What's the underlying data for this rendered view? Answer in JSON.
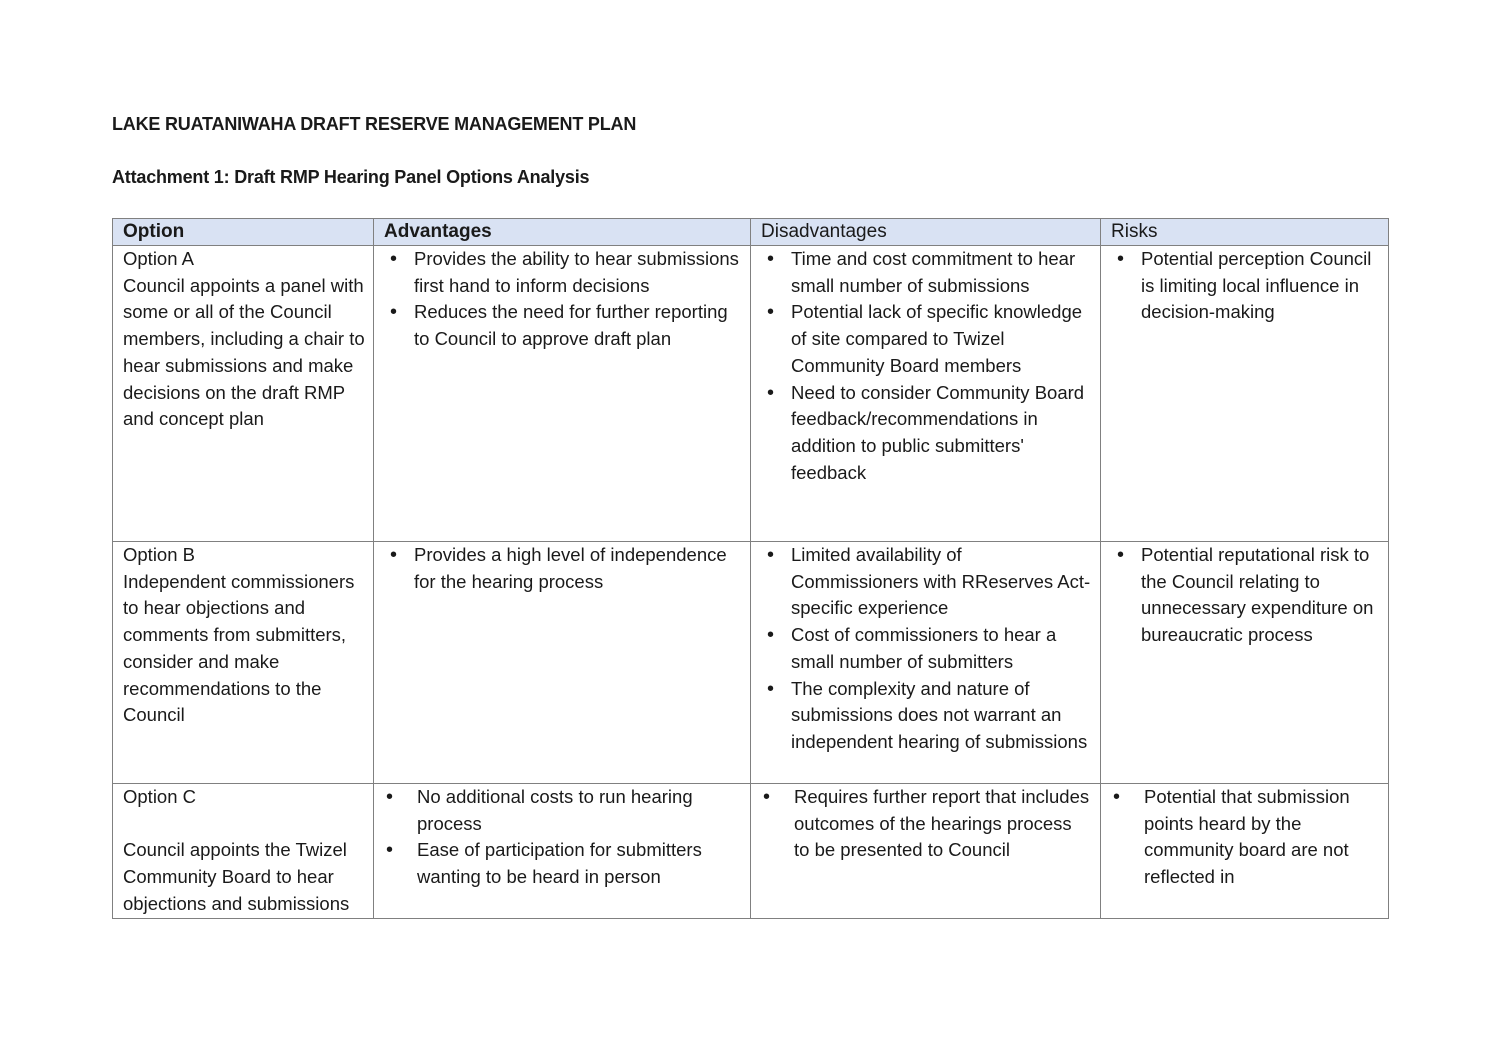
{
  "document": {
    "title": "LAKE RUATANIWAHA DRAFT RESERVE MANAGEMENT PLAN",
    "subtitle": "Attachment 1: Draft RMP Hearing Panel Options Analysis"
  },
  "table": {
    "header_bg": "#d9e2f3",
    "headers": [
      "Option",
      "Advantages",
      "Disadvantages",
      "Risks"
    ],
    "rows": [
      {
        "option_name": "Option A",
        "option_desc": "Council appoints a panel with some or all of the Council members, including a chair to hear submissions and make decisions on the draft RMP and concept plan",
        "advantages": [
          "Provides the ability to hear submissions first hand to inform decisions",
          "Reduces the need for further reporting to Council to approve draft plan"
        ],
        "disadvantages": [
          "Time and cost commitment to hear small number of submissions",
          "Potential lack of specific knowledge of site compared to Twizel Community Board members",
          "Need to consider Community Board feedback/recommendations in addition to public submitters' feedback"
        ],
        "risks": [
          "Potential perception Council is limiting local influence in decision-making"
        ]
      },
      {
        "option_name": "Option B",
        "option_desc": "Independent commissioners to hear objections and comments from submitters, consider and make recommendations to the Council",
        "advantages": [
          "Provides a high level of independence for the hearing process"
        ],
        "disadvantages": [
          "Limited availability of Commissioners with RReserves Act-specific experience",
          "Cost of commissioners to hear a small number of submitters",
          "The complexity and nature of submissions does not warrant an independent hearing of submissions"
        ],
        "risks": [
          "Potential reputational risk to the Council relating to unnecessary expenditure on bureaucratic process"
        ]
      },
      {
        "option_name": "Option C",
        "option_desc": "Council appoints the Twizel Community Board to hear objections and submissions",
        "advantages": [
          "No additional costs to run hearing process",
          "Ease of participation for submitters wanting to be heard in person"
        ],
        "disadvantages": [
          "Requires further report that includes outcomes of the hearings process to be presented to Council"
        ],
        "risks": [
          "Potential that submission points heard by the community board are not reflected in"
        ]
      }
    ]
  }
}
